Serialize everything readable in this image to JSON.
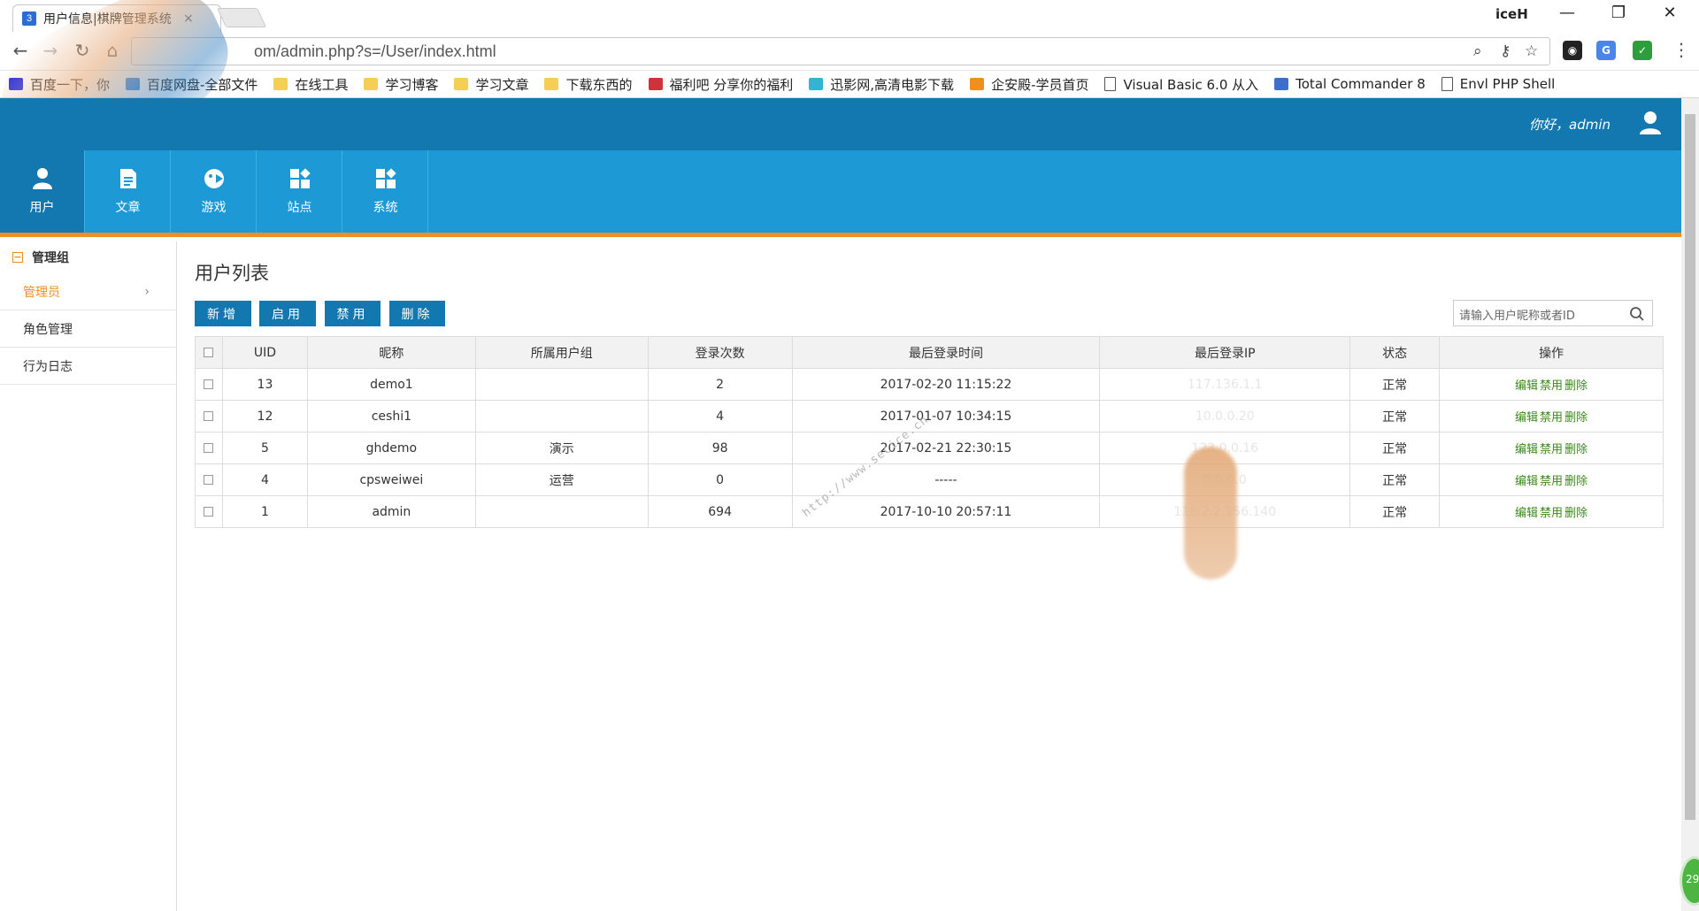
{
  "browser": {
    "tab_title": "用户信息|棋牌管理系统",
    "tab_favicon": "3",
    "tab_close": "×",
    "profile_name": "iceH",
    "window_controls": [
      "—",
      "❐",
      "✕"
    ],
    "url": "om/admin.php?s=/User/index.html",
    "bookmarks": [
      {
        "icon": "baidu-icon",
        "label": "百度一下，你"
      },
      {
        "icon": "baidu-pan-icon",
        "label": "百度网盘-全部文件"
      },
      {
        "icon": "folder-icon",
        "label": "在线工具"
      },
      {
        "icon": "folder-icon",
        "label": "学习博客"
      },
      {
        "icon": "folder-icon",
        "label": "学习文章"
      },
      {
        "icon": "folder-icon",
        "label": "下载东西的"
      },
      {
        "icon": "fuliba-icon",
        "label": "福利吧 分享你的福利"
      },
      {
        "icon": "xunying-icon",
        "label": "迅影网,高清电影下载"
      },
      {
        "icon": "qianyin-icon",
        "label": "企安殿-学员首页"
      },
      {
        "icon": "page-icon",
        "label": "Visual Basic 6.0 从入"
      },
      {
        "icon": "total-commander-icon",
        "label": "Total Commander 8"
      },
      {
        "icon": "page-icon",
        "label": "Envl PHP Shell"
      }
    ]
  },
  "header": {
    "greeting": "你好，admin"
  },
  "nav": [
    {
      "label": "用户",
      "icon": "user-icon",
      "active": true
    },
    {
      "label": "文章",
      "icon": "article-icon",
      "active": false
    },
    {
      "label": "游戏",
      "icon": "game-icon",
      "active": false
    },
    {
      "label": "站点",
      "icon": "site-icon",
      "active": false
    },
    {
      "label": "系统",
      "icon": "system-icon",
      "active": false
    }
  ],
  "sidebar": {
    "group_label": "管理组",
    "items": [
      {
        "label": "管理员",
        "active": true
      },
      {
        "label": "角色管理",
        "active": false
      },
      {
        "label": "行为日志",
        "active": false
      }
    ]
  },
  "main": {
    "title": "用户列表",
    "buttons": {
      "add": "新增",
      "enable": "启用",
      "disable": "禁用",
      "delete": "删除"
    },
    "search_placeholder": "请输入用户昵称或者ID",
    "columns": [
      "UID",
      "昵称",
      "所属用户组",
      "登录次数",
      "最后登录时间",
      "最后登录IP",
      "状态",
      "操作"
    ],
    "rows": [
      {
        "uid": "13",
        "nickname": "demo1",
        "group": "",
        "logins": "2",
        "last_time": "2017-02-20 11:15:22",
        "last_ip": "117.136.1.1",
        "status": "正常"
      },
      {
        "uid": "12",
        "nickname": "ceshi1",
        "group": "",
        "logins": "4",
        "last_time": "2017-01-07 10:34:15",
        "last_ip": "10.0.0.20",
        "status": "正常"
      },
      {
        "uid": "5",
        "nickname": "ghdemo",
        "group": "演示",
        "logins": "98",
        "last_time": "2017-02-21 22:30:15",
        "last_ip": "123.0.0.16",
        "status": "正常"
      },
      {
        "uid": "4",
        "nickname": "cpsweiwei",
        "group": "运营",
        "logins": "0",
        "last_time": "-----",
        "last_ip": "0.0.0.0",
        "status": "正常"
      },
      {
        "uid": "1",
        "nickname": "admin",
        "group": "",
        "logins": "694",
        "last_time": "2017-10-10 20:57:11",
        "last_ip": "118.2.2.156.140",
        "status": "正常"
      }
    ],
    "row_actions": {
      "edit": "编辑",
      "disable": "禁用",
      "delete": "删除"
    }
  },
  "watermark": "http://www.secice.cn",
  "badge": "29",
  "colors": {
    "header_dark": "#1377b0",
    "nav_blue": "#1d9ad6",
    "accent_orange": "#f08f1d",
    "action_green": "#3a8a18"
  }
}
